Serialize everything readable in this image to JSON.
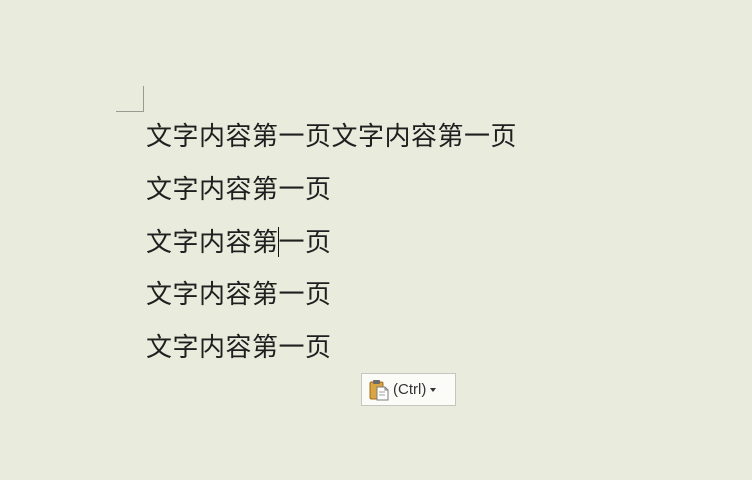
{
  "document": {
    "lines": [
      {
        "text": "文字内容第一页文字内容第一页"
      },
      {
        "text": "文字内容第一页"
      },
      {
        "before_caret": "文字内容第",
        "after_caret": "一页"
      },
      {
        "text": "文字内容第一页"
      },
      {
        "text": "文字内容第一页"
      }
    ]
  },
  "paste_options": {
    "label": "(Ctrl)",
    "icon": "clipboard-paste-icon",
    "arrow_icon": "chevron-down-icon"
  }
}
